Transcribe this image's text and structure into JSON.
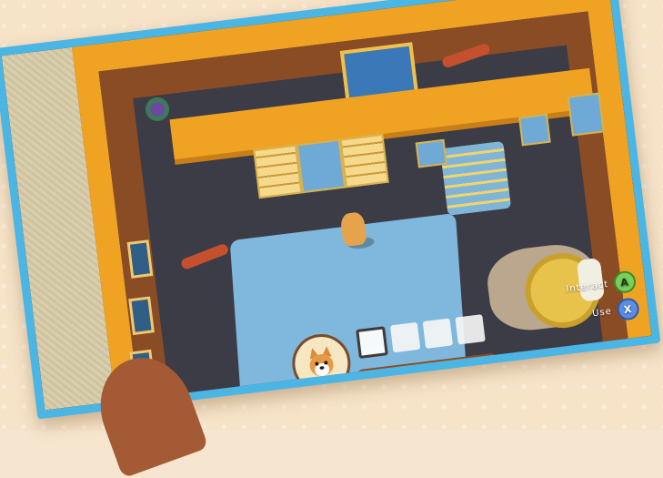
{
  "hud": {
    "interact_label": "Interact",
    "interact_button": "A",
    "use_label": "Use",
    "use_button": "X",
    "inventory_slots": 5,
    "active_slot": 1
  },
  "colors": {
    "frame": "#4bb6e4",
    "wall_orange": "#f0a323",
    "wall_wood": "#8a4c24",
    "rug": "#7fb8dc",
    "button_a": "#7ccf5a",
    "button_x": "#5b8de0"
  },
  "icons": {
    "portrait": "corgi-portrait-icon",
    "player": "corgi-player-icon",
    "bone": "bone-icon",
    "sausage": "sausage-icon"
  }
}
